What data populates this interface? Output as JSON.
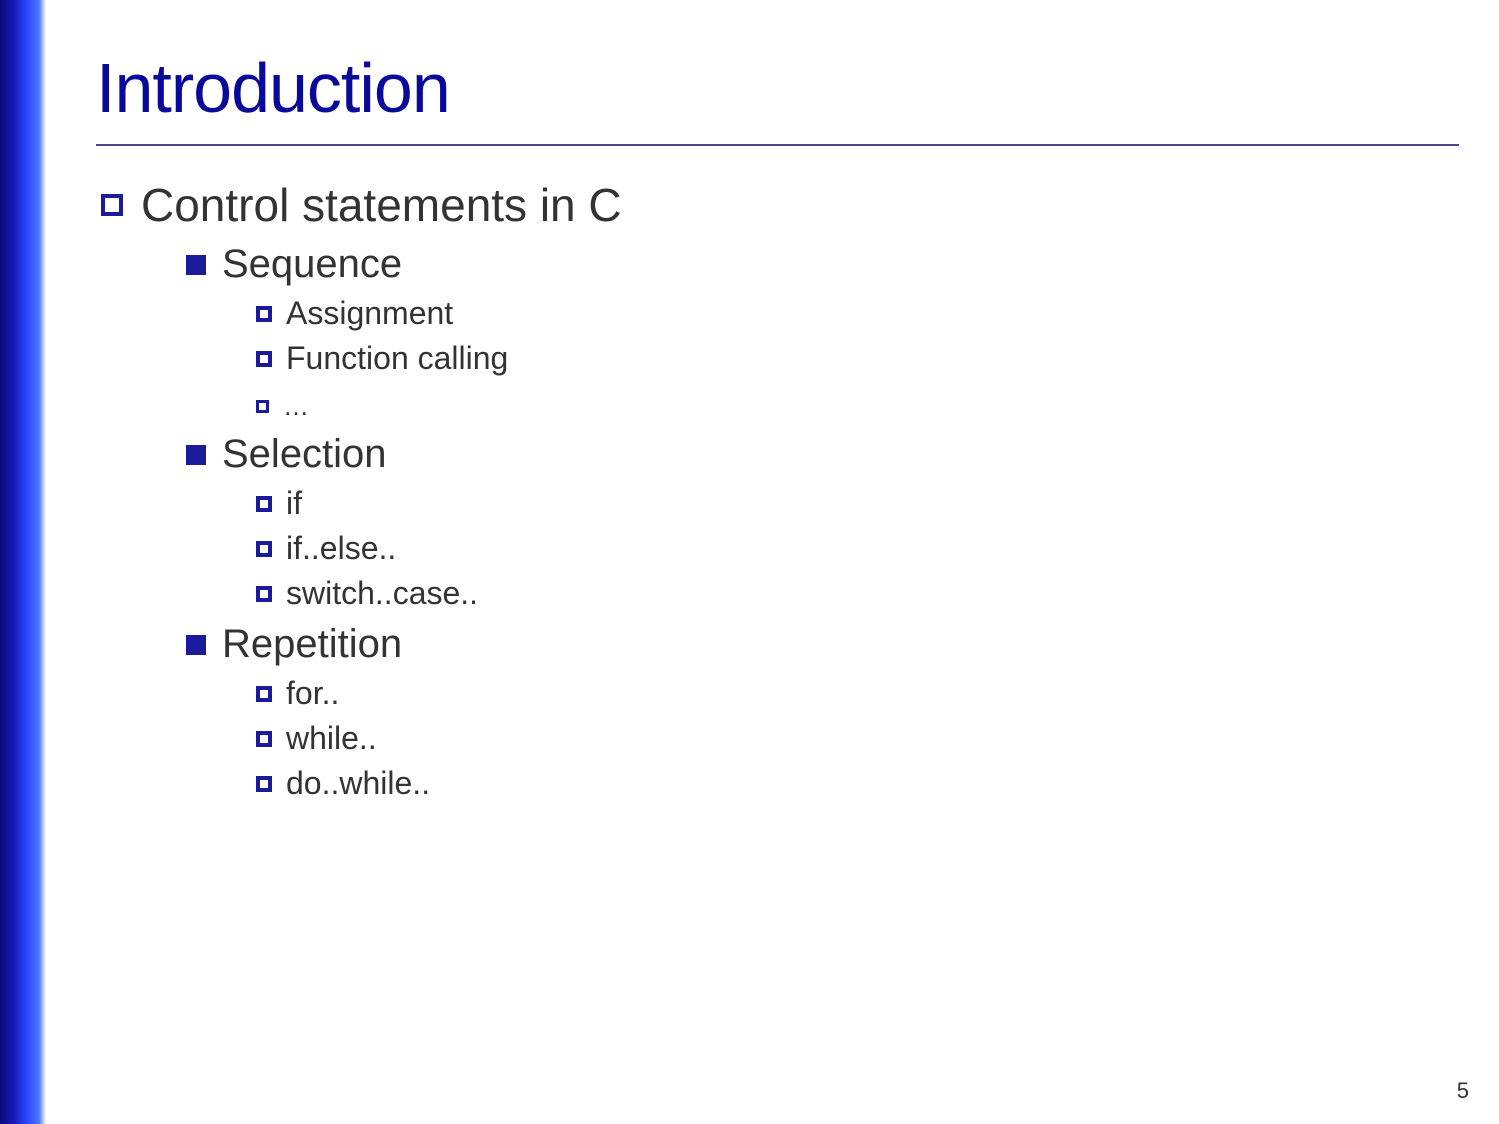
{
  "title": "Introduction",
  "page_number": "5",
  "level1": {
    "text": "Control statements in C"
  },
  "level2": [
    {
      "text": "Sequence",
      "children": [
        "Assignment",
        "Function calling",
        "…"
      ]
    },
    {
      "text": "Selection",
      "children": [
        "if",
        "if..else..",
        "switch..case.."
      ]
    },
    {
      "text": "Repetition",
      "children": [
        "for..",
        "while..",
        "do..while.."
      ]
    }
  ]
}
